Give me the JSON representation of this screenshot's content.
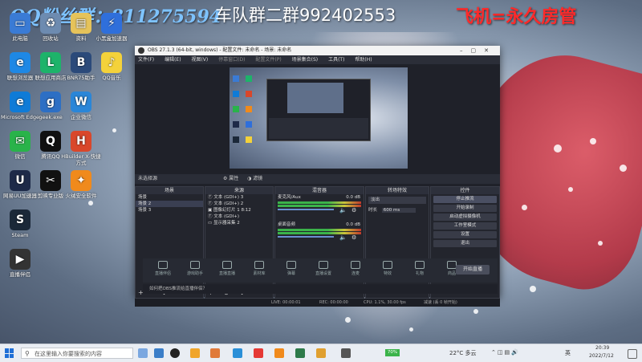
{
  "banner": {
    "qq_fans": "QQ粉丝群：811275594",
    "team": "车队群二群992402553",
    "slogan": "飞机=永久房管"
  },
  "desktop_icons": [
    {
      "label": "此电脑",
      "color": "#3a7bd5",
      "glyph": "▭"
    },
    {
      "label": "联想浏览器",
      "color": "#1e88e5",
      "glyph": "e"
    },
    {
      "label": "Microsoft Edge",
      "color": "#0f7bd7",
      "glyph": "e"
    },
    {
      "label": "微信",
      "color": "#29b34a",
      "glyph": "✉"
    },
    {
      "label": "网易UU加速器",
      "color": "#1e2a48",
      "glyph": "U"
    },
    {
      "label": "Steam",
      "color": "#1b2838",
      "glyph": "S"
    },
    {
      "label": "直播伴侣",
      "color": "#333333",
      "glyph": "▶"
    },
    {
      "label": "回收站",
      "color": "#6d8bb0",
      "glyph": "♻"
    },
    {
      "label": "联想应用商店",
      "color": "#1db36a",
      "glyph": "L"
    },
    {
      "label": "geek.exe",
      "color": "#2d6fc4",
      "glyph": "g"
    },
    {
      "label": "腾讯QQ",
      "color": "#111111",
      "glyph": "Q"
    },
    {
      "label": "剪映专业版",
      "color": "#111111",
      "glyph": "✂"
    },
    {
      "label": "资料",
      "color": "#e6c35a",
      "glyph": "▤"
    },
    {
      "label": "BNR75助手",
      "color": "#2b4a7a",
      "glyph": "B"
    },
    {
      "label": "企业微信",
      "color": "#2a86d8",
      "glyph": "W"
    },
    {
      "label": "HBuilder X-快捷方式",
      "color": "#d9472b",
      "glyph": "H"
    },
    {
      "label": "火绒安全软件",
      "color": "#f08a1c",
      "glyph": "✦"
    },
    {
      "label": "小黑盒加速器",
      "color": "#2f6fdb",
      "glyph": "⚡"
    },
    {
      "label": "QQ音乐",
      "color": "#f4d23a",
      "glyph": "♪"
    }
  ],
  "obs": {
    "title": "OBS 27.1.3 (64-bit, windows) - 配置文件: 未命名 - 场景: 未命名",
    "menu": [
      "文件(F)",
      "编辑(E)",
      "视图(V)",
      "停靠窗口(D)",
      "配置文件(P)",
      "场景集合(S)",
      "工具(T)",
      "帮助(H)"
    ],
    "source_bar": {
      "label": "未选择源",
      "props": "属性",
      "filters": "滤镜"
    },
    "scenes": {
      "header": "场景",
      "items": [
        "场景",
        "场景 2",
        "场景 3"
      ]
    },
    "sources": {
      "header": "来源",
      "items": [
        "文本 (GDI+) 3",
        "文本 (GDI+) 2",
        "图像幻灯片 1 8:12",
        "文本 (GDI+)",
        "显示器采集 2"
      ]
    },
    "mixer": {
      "header": "混音器",
      "channels": [
        {
          "name": "麦克风/Aux",
          "db": "0.0 dB"
        },
        {
          "name": "桌面音频",
          "db": "0.0 dB"
        }
      ]
    },
    "transitions": {
      "header": "转场特效",
      "type": "淡出",
      "duration_label": "时长",
      "duration": "600 ms"
    },
    "controls": {
      "header": "控件",
      "buttons": [
        "停止推流",
        "开始录制",
        "启动虚拟摄像机",
        "工作室模式",
        "设置",
        "退出"
      ]
    },
    "status": {
      "live": "LIVE: 00:00:01",
      "rec": "REC: 00:00:00",
      "cpu": "CPU: 1.1%, 30.00 fps",
      "kbps": "减速 (丢 0 帧开始)"
    }
  },
  "live_bar": {
    "tabs": [
      "直播伴侣",
      "游戏助手",
      "直播直播",
      "素材库",
      "弹幕",
      "直播设置",
      "连麦",
      "特效",
      "礼物",
      "商品"
    ],
    "start_label": "开始直播",
    "notice": "如何把OBS推流给直播伴侣？"
  },
  "taskbar": {
    "search_placeholder": "在这里输入你要搜索的内容",
    "net_badge": "70%",
    "weather": "22°C 多云",
    "lang": "英",
    "time": "20:39",
    "date": "2022/7/12"
  }
}
